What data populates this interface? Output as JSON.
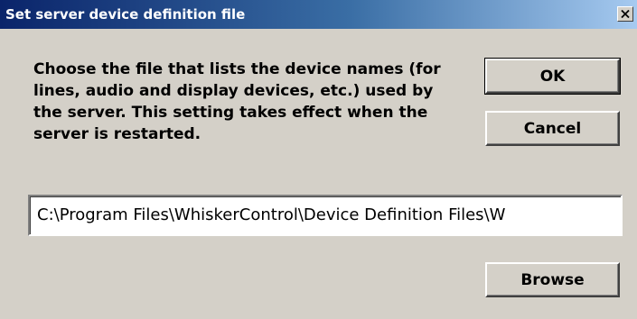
{
  "dialog": {
    "title": "Set server device definition file",
    "description": "Choose the file that lists the device names (for lines, audio and display devices, etc.) used by the server. This setting takes effect when the server is restarted.",
    "path_value": "C:\\Program Files\\WhiskerControl\\Device Definition Files\\W",
    "buttons": {
      "ok": "OK",
      "cancel": "Cancel",
      "browse": "Browse"
    },
    "icons": {
      "close": "close-icon"
    },
    "colors": {
      "titlebar_start": "#0a246a",
      "titlebar_end": "#a6caf0",
      "face": "#d4d0c8"
    }
  }
}
